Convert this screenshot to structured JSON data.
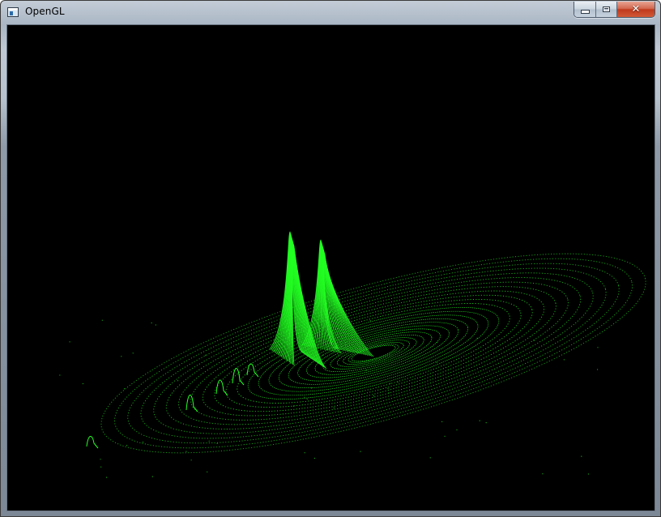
{
  "window": {
    "title": "OpenGL",
    "controls": {
      "minimize_icon": "minimize-icon",
      "maximize_icon": "maximize-icon",
      "close_icon": "close-icon",
      "close_glyph": "✕"
    }
  },
  "viewport": {
    "background": "#000000",
    "plot_color": "#22ff22"
  }
}
